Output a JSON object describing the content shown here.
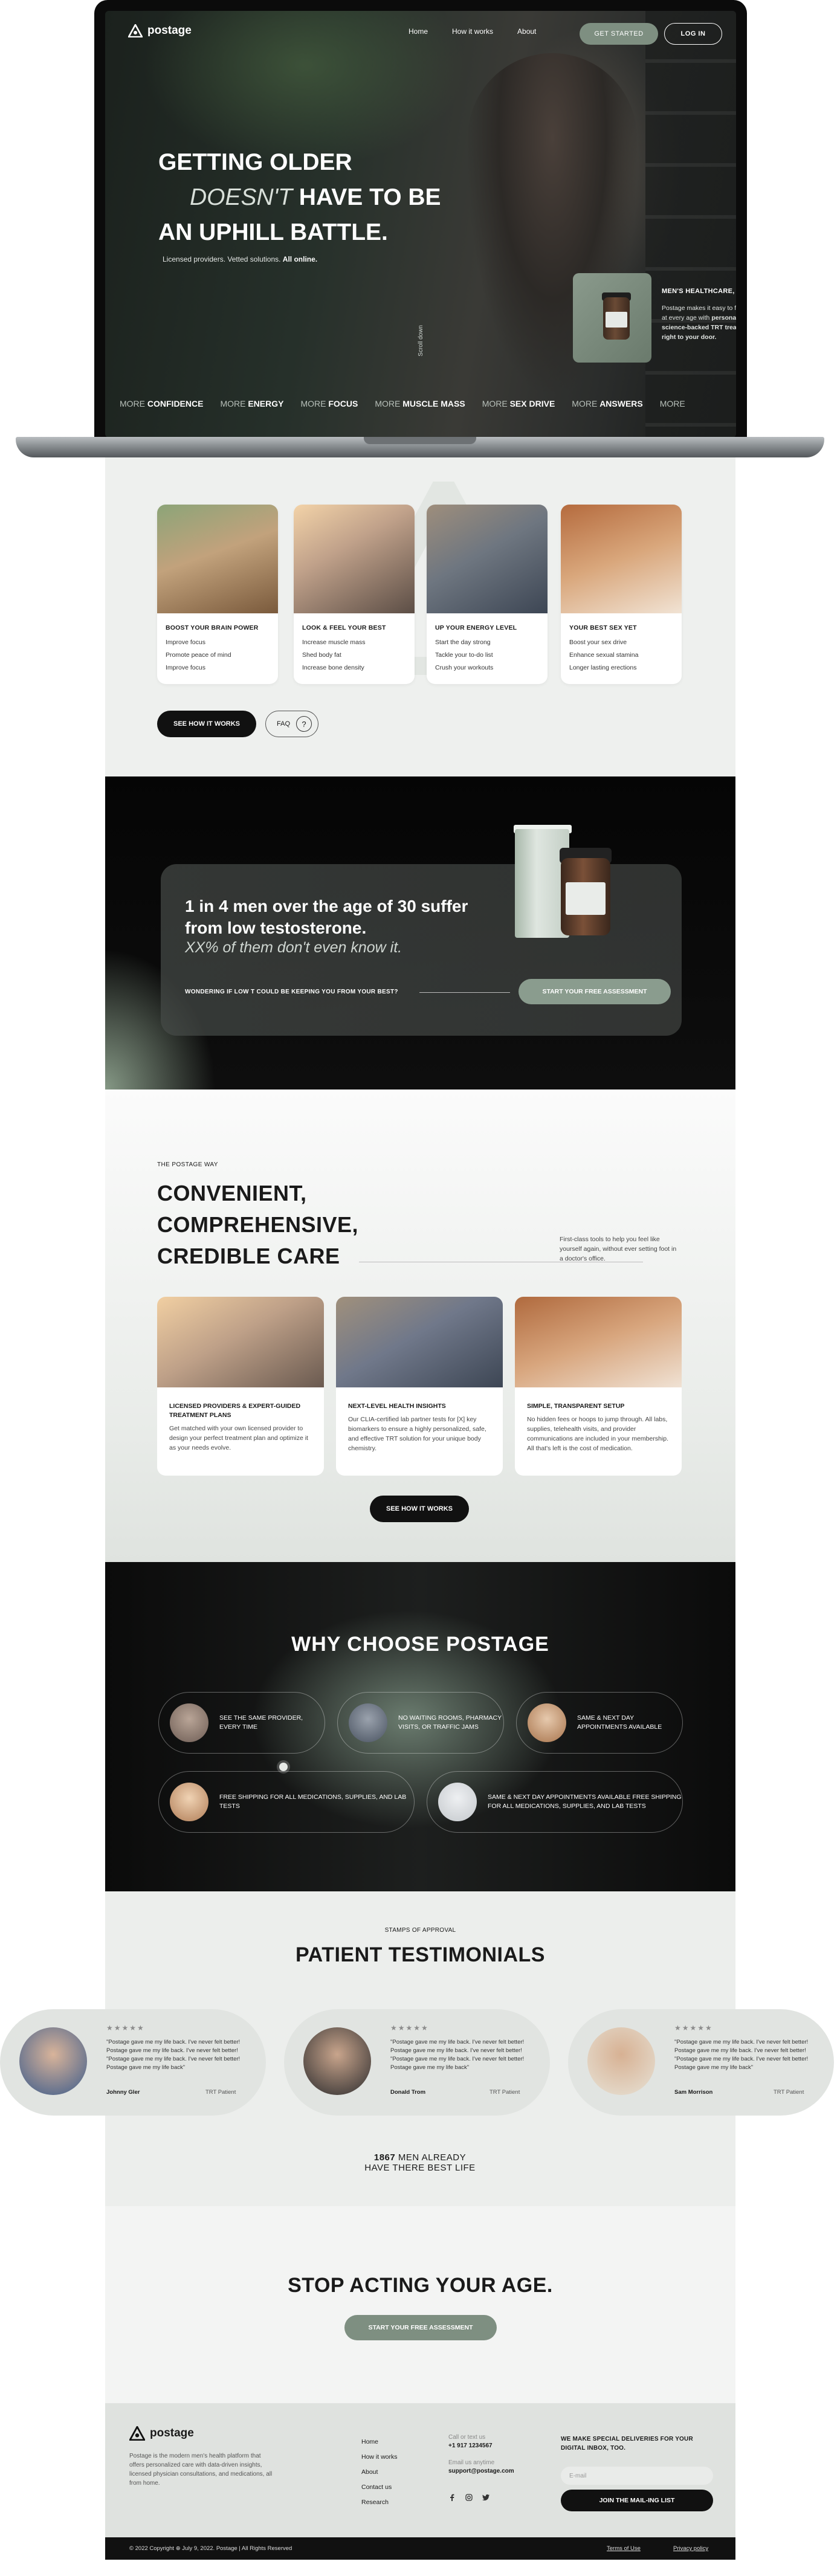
{
  "brand": {
    "name": "postage"
  },
  "nav": {
    "links": [
      "Home",
      "How it works",
      "About"
    ],
    "get_started": "GET STARTED",
    "login": "LOG IN"
  },
  "hero": {
    "line1": "GETTING OLDER",
    "line2_thin": "DOESN'T",
    "line2_bold": " HAVE TO BE",
    "line3": "AN UPHILL BATTLE.",
    "sub": "Licensed providers. Vetted solutions.",
    "sub_bold": "All online.",
    "scroll": "Scroll down",
    "promo_title": "MEN'S HEALTHCARE, DELIVERED.",
    "promo_text_a": "Postage makes it easy to feel your best at every age with",
    "promo_text_b": "personalized, science-backed TRT treatment sent right to your door."
  },
  "ticker": [
    {
      "more": "MORE",
      "word": "CONFIDENCE"
    },
    {
      "more": "MORE",
      "word": "ENERGY"
    },
    {
      "more": "MORE",
      "word": "FOCUS"
    },
    {
      "more": "MORE",
      "word": "MUSCLE MASS"
    },
    {
      "more": "MORE",
      "word": "SEX DRIVE"
    },
    {
      "more": "MORE",
      "word": "ANSWERS"
    },
    {
      "more": "MORE",
      "word": ""
    }
  ],
  "benefits": [
    {
      "title": "BOOST YOUR BRAIN POWER",
      "items": [
        "Improve focus",
        "Promote peace of mind",
        "Improve focus"
      ]
    },
    {
      "title": "LOOK & FEEL YOUR BEST",
      "items": [
        "Increase muscle mass",
        "Shed body fat",
        "Increase bone density"
      ]
    },
    {
      "title": "UP YOUR ENERGY LEVEL",
      "items": [
        "Start the day strong",
        "Tackle your to-do list",
        "Crush your workouts"
      ]
    },
    {
      "title": "YOUR BEST SEX YET",
      "items": [
        "Boost your sex drive",
        "Enhance sexual stamina",
        "Longer lasting erections"
      ]
    }
  ],
  "section1": {
    "see_how": "SEE HOW IT WORKS",
    "faq": "FAQ",
    "faq_icon": "?"
  },
  "stat": {
    "headline": "1 in 4 men over the age of 30 suffer from low testosterone.",
    "italic": "XX% of them don't even know it.",
    "question": "WONDERING IF LOW T COULD BE KEEPING YOU FROM YOUR BEST?",
    "button": "START YOUR FREE ASSESSMENT"
  },
  "care": {
    "kicker": "THE POSTAGE WAY",
    "title_lines": [
      "CONVENIENT,",
      "COMPREHENSIVE,",
      "CREDIBLE CARE"
    ],
    "side": "First-class tools to help you feel like yourself again, without ever setting foot in a doctor's office.",
    "cards": [
      {
        "title": "LICENSED PROVIDERS & EXPERT-GUIDED TREATMENT PLANS",
        "text": "Get matched with your own licensed provider to design your perfect treatment plan and optimize it as your needs evolve."
      },
      {
        "title": "NEXT-LEVEL HEALTH INSIGHTS",
        "text": "Our CLIA-certified lab partner tests for [X] key biomarkers to ensure a highly personalized, safe, and effective TRT solution for your unique body chemistry."
      },
      {
        "title": "SIMPLE, TRANSPARENT SETUP",
        "text": "No hidden fees or hoops to jump through. All labs, supplies, telehealth visits, and provider communications are included in your membership. All that's left is the cost of medication."
      }
    ],
    "button": "SEE HOW IT WORKS"
  },
  "why": {
    "title": "WHY CHOOSE POSTAGE",
    "pills": [
      "SEE THE SAME PROVIDER, EVERY TIME",
      "NO WAITING ROOMS, PHARMACY VISITS, OR TRAFFIC JAMS",
      "SAME & NEXT DAY APPOINTMENTS AVAILABLE",
      "FREE SHIPPING FOR ALL MEDICATIONS, SUPPLIES, AND LAB TESTS",
      "SAME & NEXT DAY APPOINTMENTS AVAILABLE FREE SHIPPING FOR ALL MEDICATIONS, SUPPLIES, AND LAB TESTS"
    ]
  },
  "testimonials": {
    "kicker": "STAMPS OF APPROVAL",
    "title": "PATIENT TESTIMONIALS",
    "stars": "★★★★★",
    "items": [
      {
        "quote": "\"Postage gave me my life back. I've never felt better! Postage gave me my life back. I've never felt better! \"Postage gave me my life back. I've never felt better! Postage gave me my life back\"",
        "name": "Johnny Gler",
        "role": "TRT Patient"
      },
      {
        "quote": "\"Postage gave me my life back. I've never felt better! Postage gave me my life back. I've never felt better! \"Postage gave me my life back. I've never felt better! Postage gave me my life back\"",
        "name": "Donald Trom",
        "role": "TRT Patient"
      },
      {
        "quote": "\"Postage gave me my life back. I've never felt better! Postage gave me my life back. I've never felt better! \"Postage gave me my life back. I've never felt better! Postage gave me my life back\"",
        "name": "Sam Morrison",
        "role": "TRT Patient"
      }
    ],
    "count": "1867",
    "count_text": " MEN ALREADY",
    "count_line2": "HAVE THERE BEST LIFE"
  },
  "cta": {
    "title": "STOP ACTING YOUR AGE.",
    "button": "START YOUR FREE ASSESSMENT"
  },
  "footer": {
    "desc": "Postage is the modern men's health platform that offers personalized care with data-driven insights, licensed physician consultations, and medications, all from home.",
    "links": [
      "Home",
      "How it works",
      "About",
      "Contact us",
      "Research"
    ],
    "call_label": "Call or text us",
    "phone": "+1 917 1234567",
    "email_label": "Email us anytime",
    "email": "support@postage.com",
    "news_title": "WE MAKE SPECIAL DELIVERIES FOR YOUR DIGITAL INBOX, TOO.",
    "email_placeholder": "E-mail",
    "join": "JOIN THE MAIL-ING LIST",
    "copyright": "© 2022 Copyright ⊕ July 9, 2022. Postage  | All Rights Reserved",
    "terms": "Terms of Use",
    "privacy": "Privacy policy"
  },
  "colors": {
    "sage": "#7e8f81",
    "dark": "#111111",
    "panel": "#eceeec"
  }
}
